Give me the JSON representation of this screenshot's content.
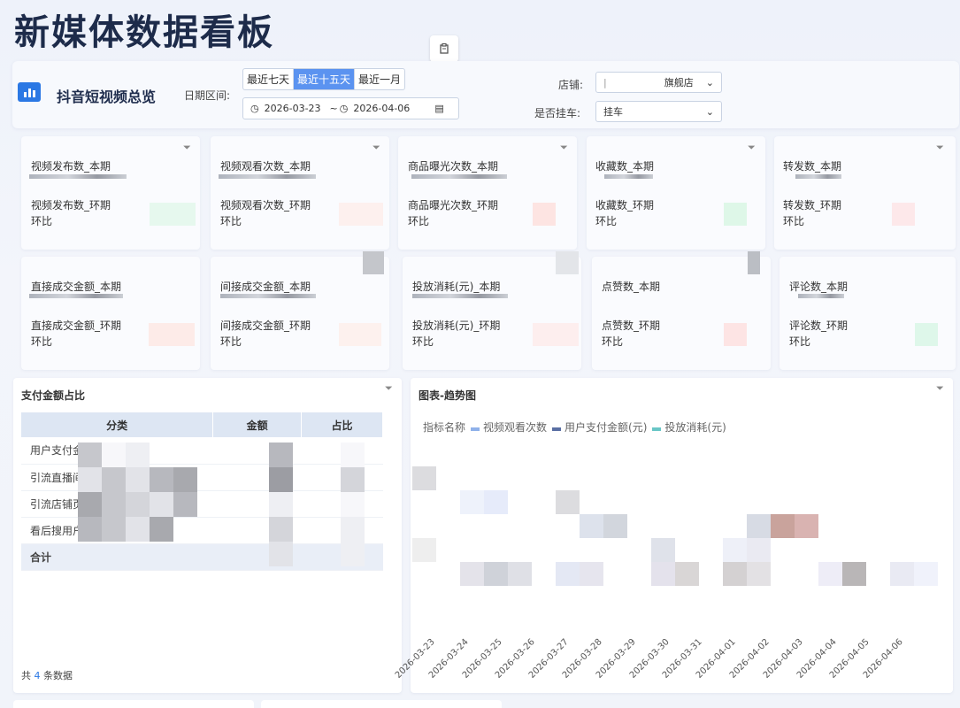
{
  "page": {
    "title": "新媒体数据看板"
  },
  "filter_bar": {
    "section_title": "抖音短视频总览",
    "date_label": "日期区间:",
    "ranges": [
      {
        "label": "最近七天",
        "active": false
      },
      {
        "label": "最近十五天",
        "active": true
      },
      {
        "label": "最近一月",
        "active": false
      }
    ],
    "start_date": "2026-03-23",
    "separator": "~",
    "end_date": "2026-04-06",
    "shop_label": "店铺:",
    "shop_value": "旗舰店",
    "cart_label": "是否挂车:",
    "cart_value": "挂车"
  },
  "metrics": [
    {
      "current": "视频发布数_本期",
      "previous": "视频发布数_环期",
      "ratio": "环比",
      "swatch": "#e6f8ee"
    },
    {
      "current": "视频观看次数_本期",
      "previous": "视频观看次数_环期",
      "ratio": "环比",
      "swatch": "#fdf0ee"
    },
    {
      "current": "商品曝光次数_本期",
      "previous": "商品曝光次数_环期",
      "ratio": "环比",
      "swatch": "#fde4e2"
    },
    {
      "current": "收藏数_本期",
      "previous": "收藏数_环期",
      "ratio": "环比",
      "swatch": "#def7e8"
    },
    {
      "current": "转发数_本期",
      "previous": "转发数_环期",
      "ratio": "环比",
      "swatch": "#fde8ea"
    },
    {
      "current": "直接成交金额_本期",
      "previous": "直接成交金额_环期",
      "ratio": "环比",
      "swatch": "#fdebe8"
    },
    {
      "current": "间接成交金额_本期",
      "previous": "间接成交金额_环期",
      "ratio": "环比",
      "swatch": "#fdf1ee"
    },
    {
      "current": "投放消耗(元)_本期",
      "previous": "投放消耗(元)_环期",
      "ratio": "环比",
      "swatch": "#fdeeee"
    },
    {
      "current": "点赞数_本期",
      "previous": "点赞数_环期",
      "ratio": "环比",
      "swatch": "#fde4e4"
    },
    {
      "current": "评论数_本期",
      "previous": "评论数_环期",
      "ratio": "环比",
      "swatch": "#def7ea"
    }
  ],
  "pay_table": {
    "title": "支付金额占比",
    "headers": [
      "分类",
      "金额",
      "占比"
    ],
    "rows": [
      "用户支付金",
      "引流直播间",
      "引流店铺页",
      "看后搜用户"
    ],
    "total": "合计",
    "footer_prefix": "共",
    "footer_count": "4",
    "footer_suffix": "条数据"
  },
  "trend": {
    "title": "图表-趋势图",
    "legend_title": "指标名称",
    "colors": {
      "views": "#8fb1ea",
      "pay": "#5a6fa3",
      "spend": "#69c6c6"
    }
  },
  "chart_data": {
    "type": "line",
    "title": "图表-趋势图",
    "categories": [
      "2026-03-23",
      "2026-03-24",
      "2026-03-25",
      "2026-03-26",
      "2026-03-27",
      "2026-03-28",
      "2026-03-29",
      "2026-03-30",
      "2026-03-31",
      "2026-04-01",
      "2026-04-02",
      "2026-04-03",
      "2026-04-04",
      "2026-04-05",
      "2026-04-06"
    ],
    "series": [
      {
        "name": "视频观看次数"
      },
      {
        "name": "用户支付金额(元)"
      },
      {
        "name": "投放消耗(元)"
      }
    ],
    "legend_title": "指标名称",
    "legend": "top-left"
  }
}
